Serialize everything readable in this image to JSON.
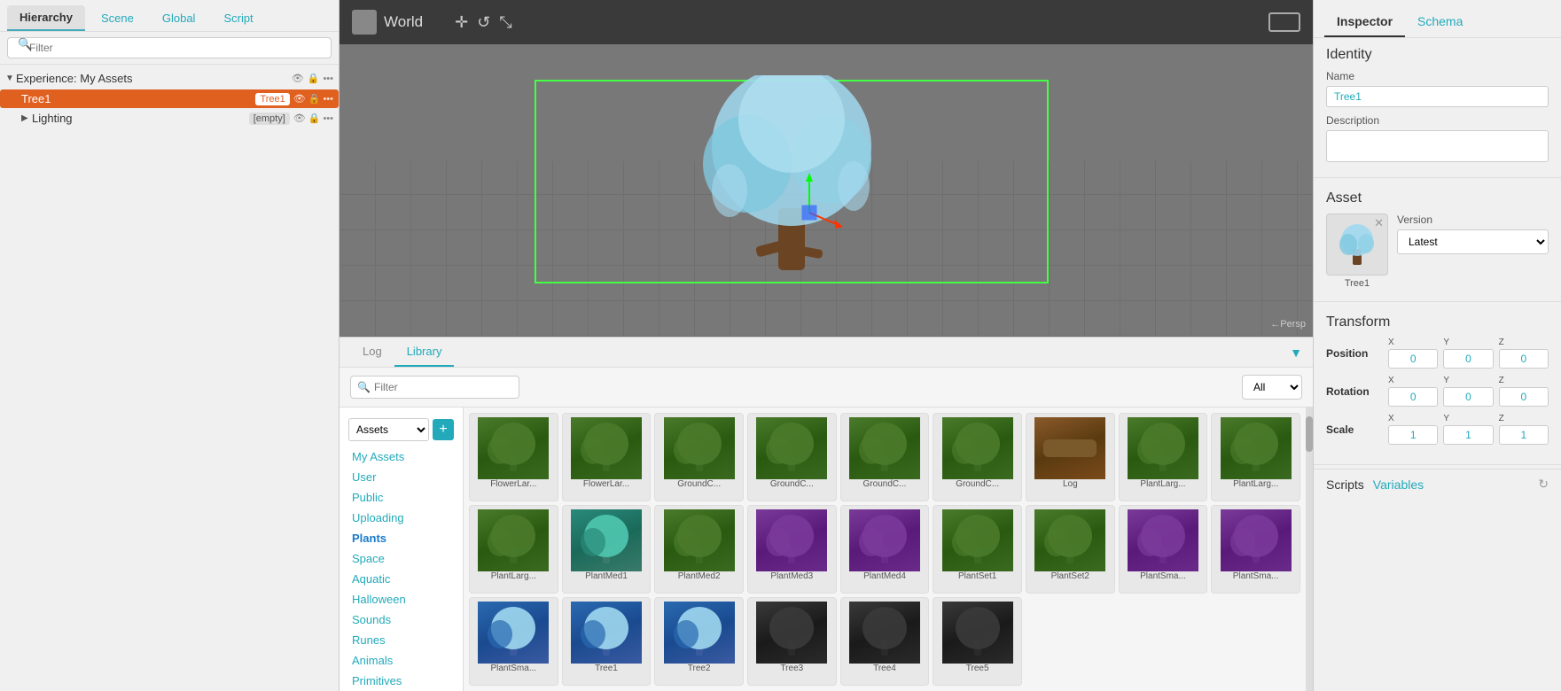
{
  "left": {
    "tabs": [
      "Hierarchy",
      "Scene",
      "Global",
      "Script"
    ],
    "active_tab": "Hierarchy",
    "filter_placeholder": "Filter",
    "experience_label": "Experience: My Assets",
    "tree1_label": "Tree1",
    "tree1_tag": "Tree1",
    "lighting_label": "Lighting",
    "lighting_tag": "[empty]"
  },
  "viewport": {
    "world_label": "World",
    "persp_label": "←Persp"
  },
  "bottom": {
    "tabs": [
      "Log",
      "Library"
    ],
    "active_tab": "Library",
    "filter_placeholder": "Filter",
    "dropdown_options": [
      "All"
    ],
    "dropdown_selected": "All",
    "sidebar_select": "Assets",
    "categories": [
      {
        "id": "my-assets",
        "label": "My Assets",
        "color": "teal"
      },
      {
        "id": "user",
        "label": "User",
        "color": "teal"
      },
      {
        "id": "public",
        "label": "Public",
        "color": "teal"
      },
      {
        "id": "uploading",
        "label": "Uploading",
        "color": "teal"
      },
      {
        "id": "plants",
        "label": "Plants",
        "color": "active",
        "active": true
      },
      {
        "id": "space",
        "label": "Space",
        "color": "teal"
      },
      {
        "id": "aquatic",
        "label": "Aquatic",
        "color": "teal"
      },
      {
        "id": "halloween",
        "label": "Halloween",
        "color": "teal"
      },
      {
        "id": "sounds",
        "label": "Sounds",
        "color": "teal"
      },
      {
        "id": "runes",
        "label": "Runes",
        "color": "teal"
      },
      {
        "id": "animals",
        "label": "Animals",
        "color": "teal"
      },
      {
        "id": "primitives",
        "label": "Primitives",
        "color": "teal"
      }
    ],
    "assets": [
      {
        "id": "a1",
        "label": "FlowerLar...",
        "color": "green"
      },
      {
        "id": "a2",
        "label": "FlowerLar...",
        "color": "green"
      },
      {
        "id": "a3",
        "label": "GroundC...",
        "color": "green"
      },
      {
        "id": "a4",
        "label": "GroundC...",
        "color": "green"
      },
      {
        "id": "a5",
        "label": "GroundC...",
        "color": "green"
      },
      {
        "id": "a6",
        "label": "GroundC...",
        "color": "green"
      },
      {
        "id": "a7",
        "label": "Log",
        "color": "brown"
      },
      {
        "id": "a8",
        "label": "PlantLarg...",
        "color": "green"
      },
      {
        "id": "a9",
        "label": "PlantLarg...",
        "color": "green"
      },
      {
        "id": "a10",
        "label": "PlantLarg...",
        "color": "green"
      },
      {
        "id": "a11",
        "label": "PlantMed1",
        "color": "teal"
      },
      {
        "id": "a12",
        "label": "PlantMed2",
        "color": "green"
      },
      {
        "id": "a13",
        "label": "PlantMed3",
        "color": "purple"
      },
      {
        "id": "a14",
        "label": "PlantMed4",
        "color": "purple"
      },
      {
        "id": "a15",
        "label": "PlantSet1",
        "color": "green"
      },
      {
        "id": "a16",
        "label": "PlantSet2",
        "color": "green"
      },
      {
        "id": "a17",
        "label": "PlantSma...",
        "color": "purple"
      },
      {
        "id": "a18",
        "label": "PlantSma...",
        "color": "purple"
      },
      {
        "id": "a19",
        "label": "PlantSma...",
        "color": "blue"
      },
      {
        "id": "a20",
        "label": "Tree1",
        "color": "blue"
      },
      {
        "id": "a21",
        "label": "Tree2",
        "color": "blue"
      },
      {
        "id": "a22",
        "label": "Tree3",
        "color": "dark"
      },
      {
        "id": "a23",
        "label": "Tree4",
        "color": "dark"
      },
      {
        "id": "a24",
        "label": "Tree5",
        "color": "dark"
      }
    ]
  },
  "inspector": {
    "tabs": [
      "Inspector",
      "Schema"
    ],
    "active_tab": "Inspector",
    "identity_title": "Identity",
    "name_label": "Name",
    "name_value": "Tree1",
    "description_label": "Description",
    "description_value": "",
    "asset_title": "Asset",
    "asset_label": "Tree1",
    "version_label": "Version",
    "version_value": "Latest",
    "version_options": [
      "Latest"
    ],
    "transform_title": "Transform",
    "position_label": "Position",
    "rotation_label": "Rotation",
    "scale_label": "Scale",
    "axes": [
      "X",
      "Y",
      "Z"
    ],
    "position_values": {
      "x": "0",
      "y": "0",
      "z": "0"
    },
    "rotation_values": {
      "x": "0",
      "y": "0",
      "z": "0"
    },
    "scale_values": {
      "x": "1",
      "y": "1",
      "z": "1"
    },
    "scripts_label": "Scripts",
    "variables_label": "Variables"
  }
}
